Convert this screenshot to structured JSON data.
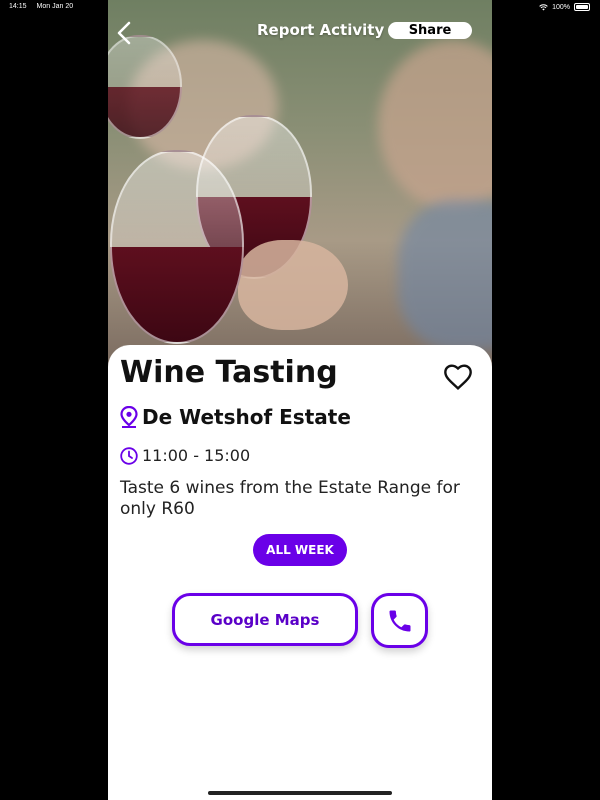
{
  "status_bar": {
    "time": "14:15",
    "date": "Mon Jan 20",
    "battery": "100%"
  },
  "header": {
    "back_icon": "chevron-left-icon",
    "report_label": "Report Activity",
    "share_label": "Share"
  },
  "event": {
    "title": "Wine Tasting",
    "location": "De Wetshof Estate",
    "time": "11:00 - 15:00",
    "description": "Taste 6 wines from the Estate Range for only R60",
    "badge": "ALL WEEK"
  },
  "actions": {
    "maps_label": "Google Maps",
    "call_icon": "phone-icon",
    "favorite_icon": "heart-outline-icon"
  },
  "colors": {
    "accent": "#6a00e8",
    "background": "#ffffff",
    "frame": "#000000"
  }
}
